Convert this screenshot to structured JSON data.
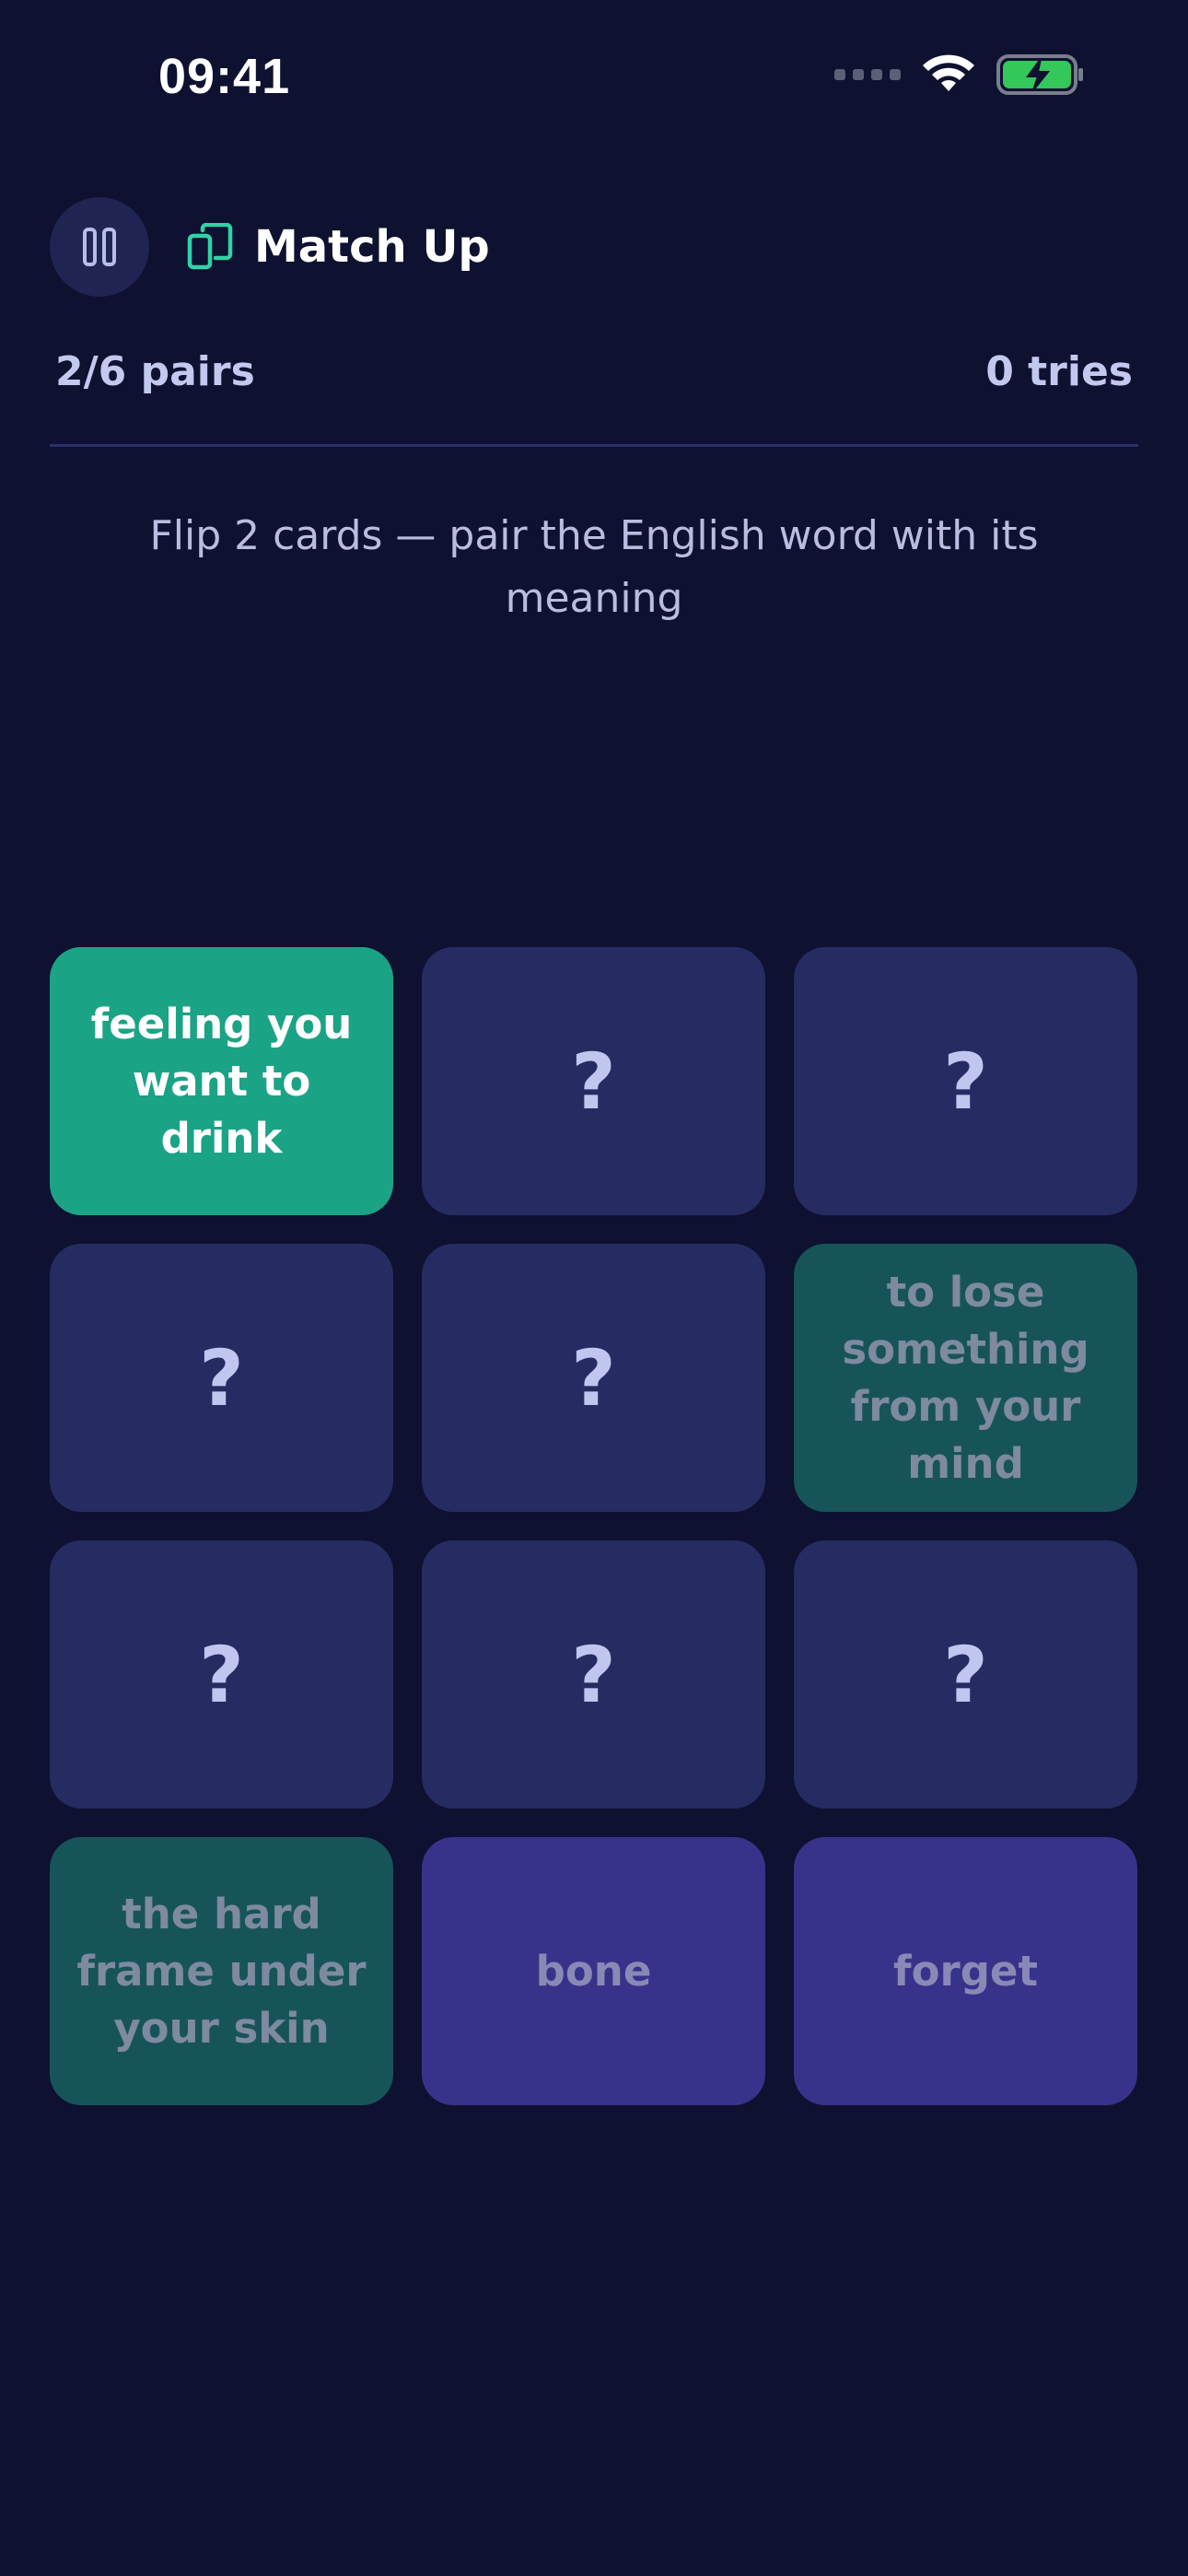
{
  "status_bar": {
    "time": "09:41",
    "icons": [
      "signal-icon",
      "wifi-icon",
      "battery-charging-icon"
    ]
  },
  "header": {
    "pause_icon": "pause-icon",
    "logo_icon": "cards-icon",
    "title": "Match Up"
  },
  "stats": {
    "pairs": "2/6 pairs",
    "tries": "0 tries"
  },
  "instruction": "Flip 2 cards — pair the English word with its meaning",
  "colors": {
    "background": "#0e1130",
    "card_hidden": "#262b62",
    "card_flipped": "#1ba386",
    "card_matched_meaning": "#17545a",
    "card_matched_word": "#38338a",
    "accent": "#2fd3a6"
  },
  "cards": [
    {
      "state": "flipped",
      "label": "feeling you want to drink"
    },
    {
      "state": "hidden",
      "label": "?"
    },
    {
      "state": "hidden",
      "label": "?"
    },
    {
      "state": "hidden",
      "label": "?"
    },
    {
      "state": "hidden",
      "label": "?"
    },
    {
      "state": "matched-meaning",
      "label": "to lose something from your mind"
    },
    {
      "state": "hidden",
      "label": "?"
    },
    {
      "state": "hidden",
      "label": "?"
    },
    {
      "state": "hidden",
      "label": "?"
    },
    {
      "state": "matched-meaning",
      "label": "the hard frame under your skin"
    },
    {
      "state": "matched-word",
      "label": "bone"
    },
    {
      "state": "matched-word",
      "label": "forget"
    }
  ]
}
